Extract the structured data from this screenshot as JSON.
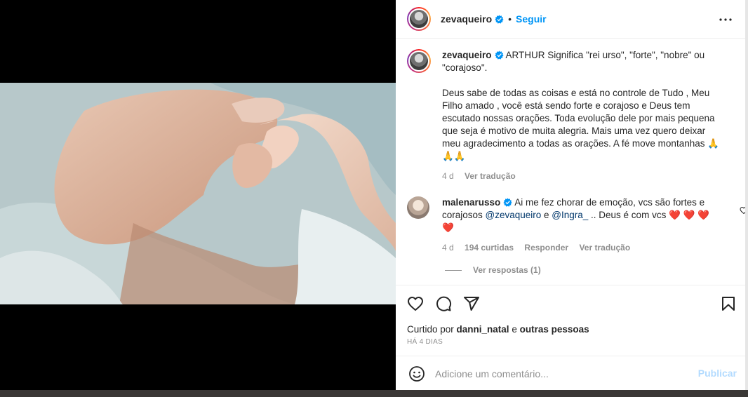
{
  "post": {
    "username": "zevaqueiro",
    "follow_label": "Seguir",
    "caption_user": "zevaqueiro",
    "caption_line1": " ARTHUR Significa \"rei urso\", \"forte\", \"nobre\" ou \"corajoso\".",
    "caption_para2": "Deus sabe de todas as coisas e está no controle de Tudo , Meu Filho amado , você está sendo forte e corajoso e Deus tem escutado nossas orações. Toda evolução dele por mais pequena que seja é motivo de muita alegria. Mais uma vez quero deixar meu agradecimento a todas as orações. A fé move montanhas 🙏 🙏🙏",
    "caption_age": "4 d",
    "caption_translate": "Ver tradução"
  },
  "comment": {
    "username": "malenarusso",
    "text_before": " Ai me fez chorar de emoção, vcs são fortes e corajosos ",
    "mention1": "@zevaqueiro",
    "text_mid": " e ",
    "mention2": "@Ingra_",
    "text_after": " .. Deus é com vcs ❤️ ❤️ ❤️ ❤️",
    "age": "4 d",
    "likes": "194 curtidas",
    "reply": "Responder",
    "translate": "Ver tradução",
    "view_replies": "Ver respostas (1)"
  },
  "footer": {
    "liked_by_prefix": "Curtido por ",
    "liked_by_user": "danni_natal",
    "liked_by_suffix": " e ",
    "liked_by_others": "outras pessoas",
    "timestamp": "HÁ 4 DIAS",
    "comment_placeholder": "Adicione um comentário...",
    "publish_label": "Publicar"
  },
  "icons": {
    "verified": "verified-badge-icon",
    "more": "more-options-icon",
    "like": "heart-icon",
    "comment": "comment-icon",
    "share": "share-icon",
    "save": "bookmark-icon",
    "emoji": "emoji-icon"
  },
  "colors": {
    "accent": "#0095f6",
    "text": "#262626",
    "muted": "#8e8e8e",
    "publish_disabled": "#b3dbff"
  }
}
